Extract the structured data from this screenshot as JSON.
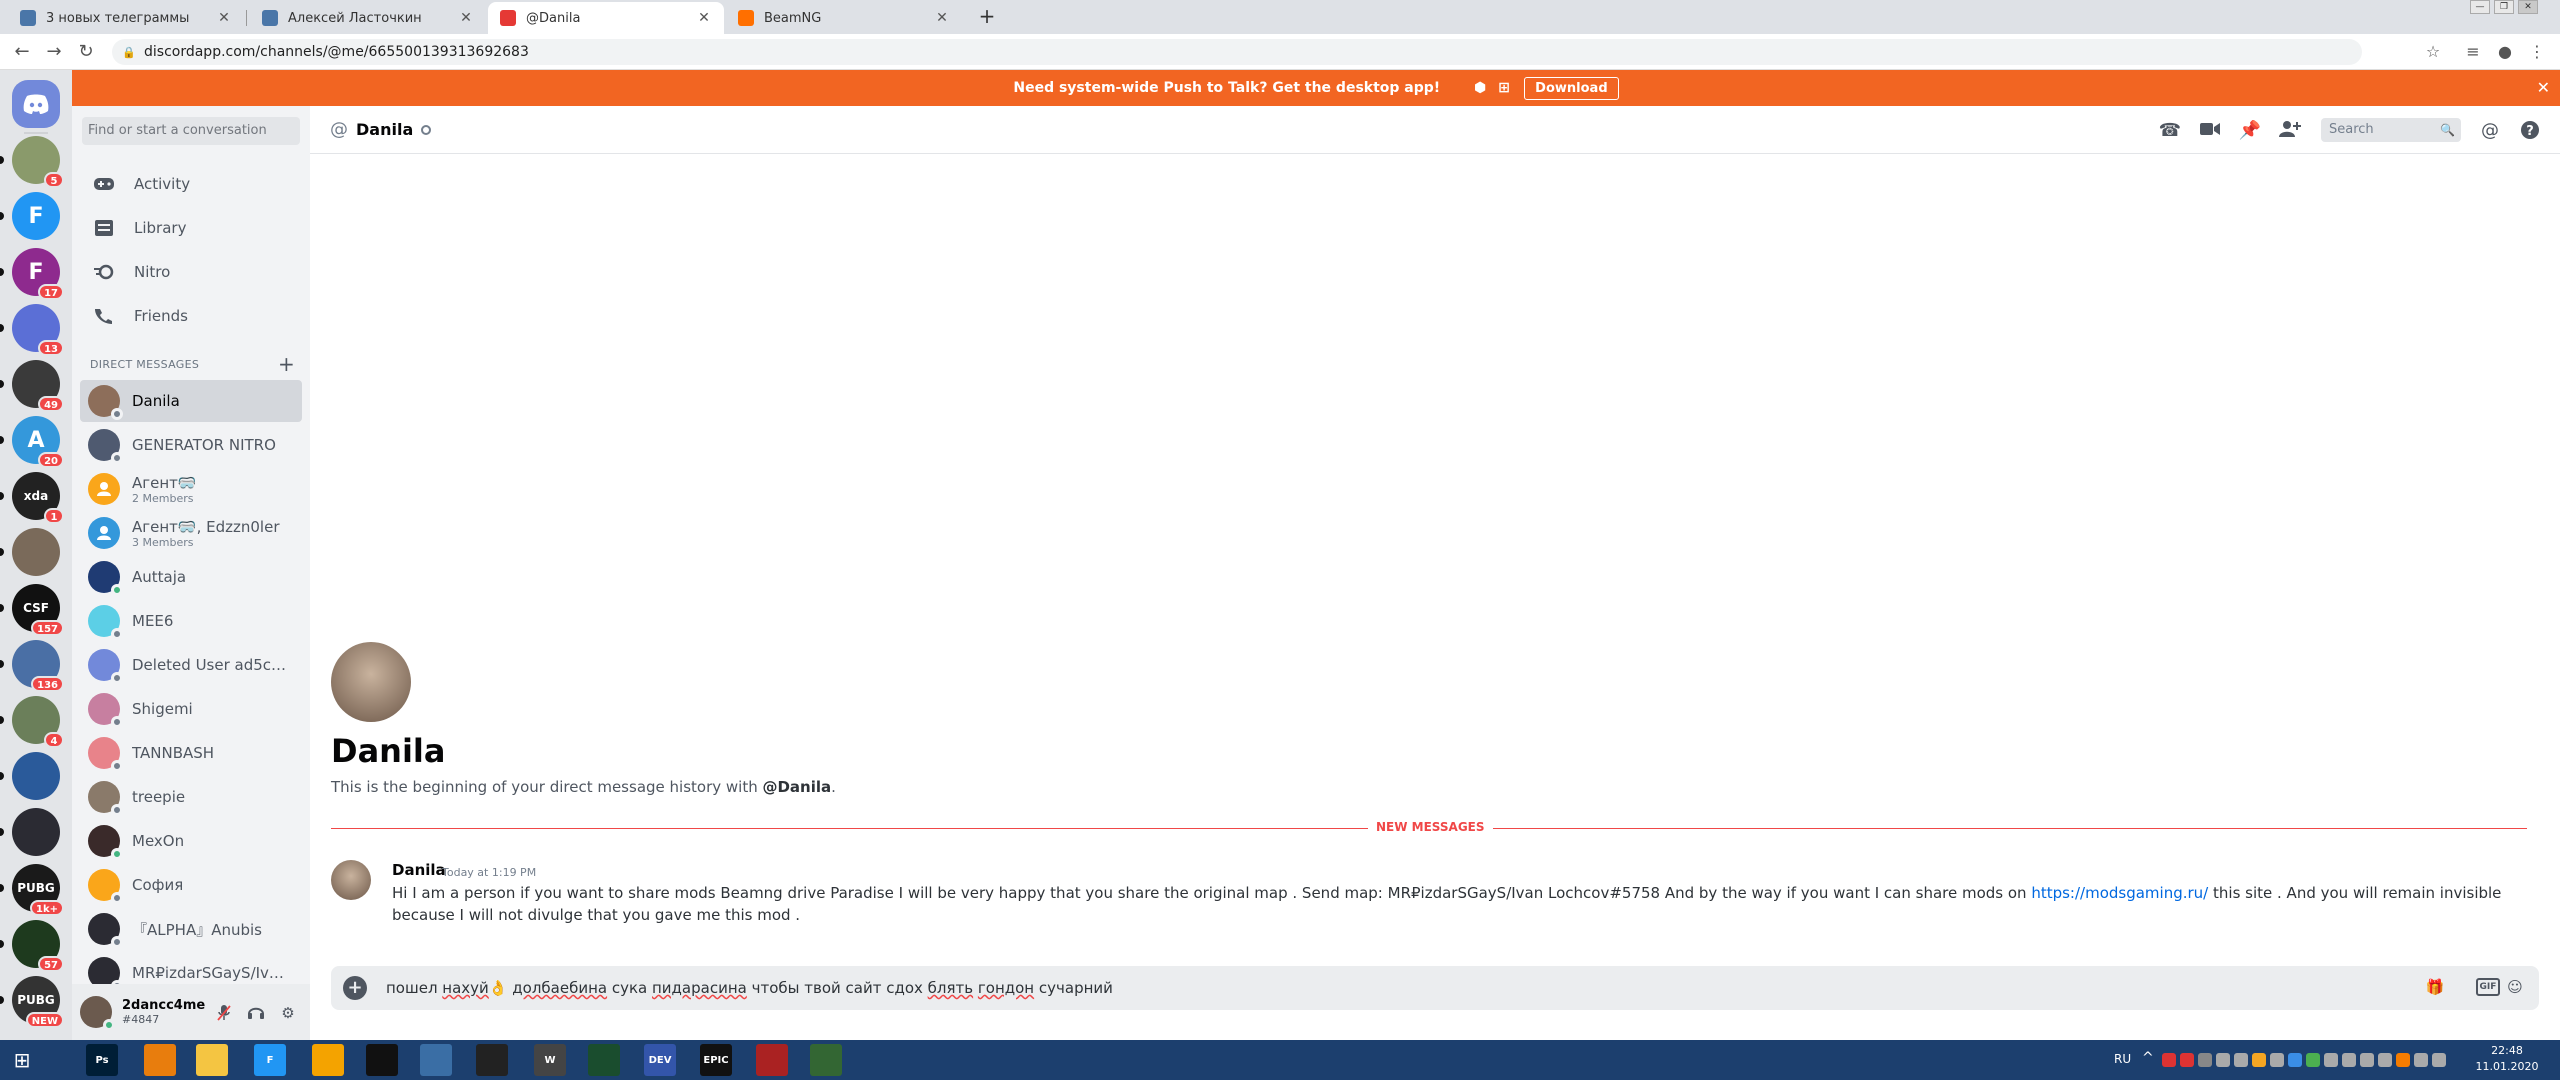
{
  "browser": {
    "tabs": [
      {
        "title": "3 новых телеграммы",
        "favicon_color": "#4a76a8",
        "favicon_text": "3"
      },
      {
        "title": "Алексей Ласточкин",
        "favicon_color": "#4a76a8",
        "favicon_text": "VK"
      },
      {
        "title": "@Danila",
        "favicon_color": "#e53935",
        "favicon_text": "D"
      },
      {
        "title": "BeamNG",
        "favicon_color": "#ff6f00",
        "favicon_text": "B"
      }
    ],
    "new_tab": "+",
    "url": "discordapp.com/channels/@me/665500139313692683"
  },
  "banner": {
    "text": "Need system-wide Push to Talk? Get the desktop app!",
    "download": "Download",
    "color": "#f26522"
  },
  "servers": [
    {
      "color": "#7289da",
      "badge": "",
      "home": true
    },
    {
      "color": "#8a9a6b",
      "badge": "5"
    },
    {
      "color": "#2196f3",
      "badge": "",
      "letter": "F"
    },
    {
      "color": "#8e2a8e",
      "badge": "17",
      "letter": "F"
    },
    {
      "color": "#5b6fd6",
      "badge": "13"
    },
    {
      "color": "#3a3a3a",
      "badge": "49"
    },
    {
      "color": "#3498db",
      "badge": "20",
      "letter": "A"
    },
    {
      "color": "#222222",
      "badge": "1",
      "letter": "xda"
    },
    {
      "color": "#7a6a5a",
      "badge": ""
    },
    {
      "color": "#111111",
      "badge": "157",
      "letter": "CSF"
    },
    {
      "color": "#4a6fa5",
      "badge": "136"
    },
    {
      "color": "#6b7f5a",
      "badge": "4"
    },
    {
      "color": "#2a5a9a",
      "badge": ""
    },
    {
      "color": "#2b2b33",
      "badge": ""
    },
    {
      "color": "#1a1a1a",
      "badge": "1k+",
      "letter": "PUBG"
    },
    {
      "color": "#1e3a1e",
      "badge": "57"
    },
    {
      "color": "#333333",
      "badge": "NEW",
      "letter": "PUBG"
    }
  ],
  "sidebar": {
    "search_placeholder": "Find or start a conversation",
    "nav": [
      {
        "label": "Activity",
        "icon": "gamepad-icon"
      },
      {
        "label": "Library",
        "icon": "library-icon"
      },
      {
        "label": "Nitro",
        "icon": "nitro-icon"
      },
      {
        "label": "Friends",
        "icon": "friends-icon"
      }
    ],
    "dm_header": "DIRECT MESSAGES",
    "dms": [
      {
        "name": "Danila",
        "sub": "",
        "color": "#8d6e5a",
        "online": false,
        "selected": true
      },
      {
        "name": "GENERATOR NITRO",
        "sub": "",
        "color": "#4f5a70",
        "online": false
      },
      {
        "name": "Агент🥽",
        "sub": "2 Members",
        "color": "#faa61a",
        "online": false,
        "group": true
      },
      {
        "name": "Агент🥽, Edzzn0ler",
        "sub": "3 Members",
        "color": "#3498db",
        "online": false,
        "group": true
      },
      {
        "name": "Auttaja",
        "sub": "",
        "color": "#1f3b73",
        "online": true
      },
      {
        "name": "MEE6",
        "sub": "",
        "color": "#5ccfe6",
        "online": false
      },
      {
        "name": "Deleted User ad5c7b...",
        "sub": "",
        "color": "#7289da",
        "online": false
      },
      {
        "name": "Shigemi",
        "sub": "",
        "color": "#c77fa0",
        "online": false
      },
      {
        "name": "TANNBASH",
        "sub": "",
        "color": "#e8838a",
        "online": false
      },
      {
        "name": "treepie",
        "sub": "",
        "color": "#8a7a6a",
        "online": false
      },
      {
        "name": "MexOn",
        "sub": "",
        "color": "#3a2a2a",
        "online": true
      },
      {
        "name": "София",
        "sub": "",
        "color": "#faa61a",
        "online": false
      },
      {
        "name": "『ALPHA』Anubis",
        "sub": "",
        "color": "#2b2b33",
        "online": false
      },
      {
        "name": "MR₽izdarSGayS/Ivan...",
        "sub": "",
        "color": "#2b2b33",
        "online": false
      }
    ]
  },
  "user": {
    "name": "2dancc4me",
    "tag": "#4847"
  },
  "channel": {
    "at": "@",
    "name": "Danila",
    "search_placeholder": "Search"
  },
  "welcome": {
    "name": "Danila",
    "text_prefix": "This is the beginning of your direct message history with ",
    "mention": "@Danila",
    "text_suffix": "."
  },
  "divider": "NEW MESSAGES",
  "message": {
    "author": "Danila",
    "time": "Today at 1:19 PM",
    "text_before": "Hi I am a person if you want to share mods Beamng drive Paradise I will be very happy that you share the original map . Send map: MR₽izdarSGayS/Ivan Lochcov#5758 And by the way if you want I can share mods on ",
    "link": "https://modsgaming.ru/",
    "text_after": " this site . And you will remain invisible because I will not divulge that you gave me this mod ."
  },
  "composer": {
    "w1": "пошел ",
    "w2": "нахуй",
    "w3": "👌 ",
    "w4": "долбаебина",
    "w5": " сука ",
    "w6": "пидарасина",
    "w7": " чтобы твой сайт сдох ",
    "w8": "блять",
    "w9": " ",
    "w10": "гондон",
    "w11": " сучарний",
    "gif": "GIF"
  },
  "taskbar": {
    "lang": "RU",
    "time": "22:48",
    "date": "11.01.2020",
    "apps": [
      {
        "color": "#001e36",
        "label": "Ps"
      },
      {
        "color": "#e87d0d",
        "label": ""
      },
      {
        "color": "#f4c542",
        "label": ""
      },
      {
        "color": "#2196f3",
        "label": "F"
      },
      {
        "color": "#f4a300",
        "label": ""
      },
      {
        "color": "#111111",
        "label": ""
      },
      {
        "color": "#3a6ea5",
        "label": ""
      },
      {
        "color": "#222222",
        "label": ""
      },
      {
        "color": "#444444",
        "label": "W"
      },
      {
        "color": "#1a4d2e",
        "label": ""
      },
      {
        "color": "#3355aa",
        "label": "DEV"
      },
      {
        "color": "#111111",
        "label": "EPIC"
      },
      {
        "color": "#aa2222",
        "label": ""
      },
      {
        "color": "#336633",
        "label": ""
      }
    ]
  }
}
